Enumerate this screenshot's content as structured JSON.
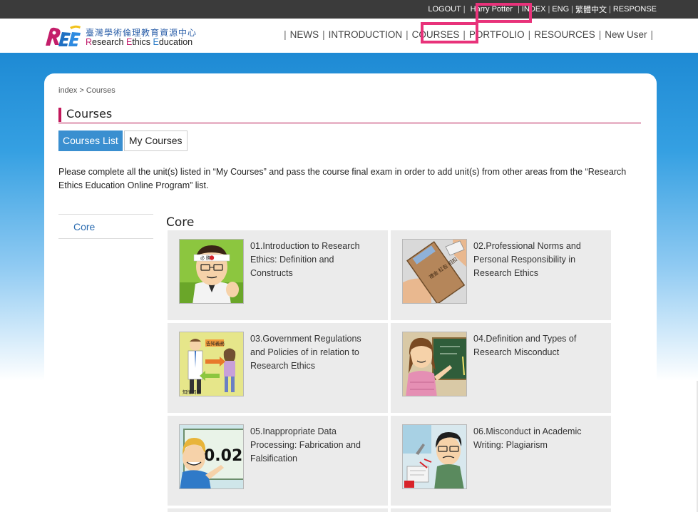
{
  "topbar": {
    "logout": "LOGOUT",
    "user": "Harry Potter",
    "index": "INDEX",
    "eng": "ENG",
    "chinese": "繁體中文",
    "response": "RESPONSE"
  },
  "logo": {
    "chinese": "臺灣學術倫理教育資源中心",
    "en_research": "R",
    "en_research_rest": "esearch ",
    "en_ethics": "E",
    "en_ethics_rest": "thics ",
    "en_education": "E",
    "en_education_rest": "ducation"
  },
  "nav": {
    "items": [
      {
        "label": "NEWS"
      },
      {
        "label": "INTRODUCTION"
      },
      {
        "label": "COURSES"
      },
      {
        "label": "PORTFOLIO"
      },
      {
        "label": "RESOURCES"
      },
      {
        "label": "New User"
      }
    ]
  },
  "breadcrumb": "index > Courses",
  "page_title": "Courses",
  "tabs": [
    {
      "label": "Courses List"
    },
    {
      "label": "My Courses"
    }
  ],
  "notice": "Please complete all the unit(s) listed in “My Courses” and pass the course final exam in order to add unit(s) from other areas from the “Research Ethics Education Online Program” list.",
  "sidebar": {
    "core": "Core"
  },
  "section_title": "Core",
  "courses": [
    {
      "title": "01.Introduction to Research Ethics: Definition and Constructs"
    },
    {
      "title": "02.Professional Norms and Personal Responsibility in Research Ethics"
    },
    {
      "title": "03.Government Regulations and Policies of in relation to Research Ethics"
    },
    {
      "title": "04.Definition and Types of Research Misconduct"
    },
    {
      "title": "05.Inappropriate Data Processing: Fabrication and Falsification"
    },
    {
      "title": "06.Misconduct in Academic Writing: Plagiarism"
    }
  ],
  "thumb_text": {
    "headband": "必 勝",
    "envelope": "禮金 紅包 回扣",
    "notify": "告知義務",
    "consent": "知情同意",
    "number": "0.02"
  },
  "colors": {
    "accent_pink": "#e8327a",
    "title_bar": "#c2185b",
    "tab_active": "#3a8fd0",
    "band_blue": "#1e8ad4"
  }
}
